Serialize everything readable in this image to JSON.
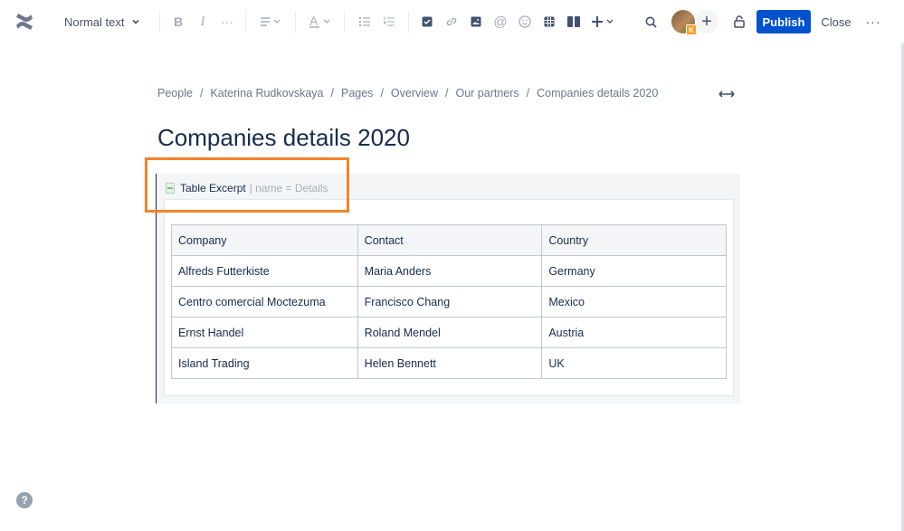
{
  "toolbar": {
    "text_style": "Normal text",
    "publish_label": "Publish",
    "close_label": "Close",
    "avatar_badge": "K",
    "icons": [
      "bold-icon",
      "italic-icon",
      "more-formatting-icon",
      "align-icon",
      "text-color-icon",
      "bullet-list-icon",
      "numbered-list-icon",
      "action-item-icon",
      "link-icon",
      "image-icon",
      "mention-icon",
      "emoji-icon",
      "table-icon",
      "layout-icon",
      "insert-icon",
      "search-icon",
      "restrictions-icon",
      "more-icon"
    ]
  },
  "breadcrumb": {
    "items": [
      "People",
      "Katerina Rudkovskaya",
      "Pages",
      "Overview",
      "Our partners",
      "Companies details 2020"
    ],
    "separator": "/"
  },
  "page": {
    "title": "Companies details 2020"
  },
  "macro": {
    "title": "Table Excerpt",
    "params": "| name = Details",
    "highlight_color": "#f5822a"
  },
  "table": {
    "headers": [
      "Company",
      "Contact",
      "Country"
    ],
    "rows": [
      [
        "Alfreds Futterkiste",
        "Maria Anders",
        "Germany"
      ],
      [
        "Centro comercial Moctezuma",
        "Francisco Chang",
        "Mexico"
      ],
      [
        "Ernst Handel",
        "Roland Mendel",
        "Austria"
      ],
      [
        "Island Trading",
        "Helen Bennett",
        "UK"
      ]
    ]
  },
  "help": {
    "label": "?"
  },
  "colors": {
    "primary": "#0052cc",
    "text": "#172b4d",
    "subtle": "#6b778c"
  }
}
